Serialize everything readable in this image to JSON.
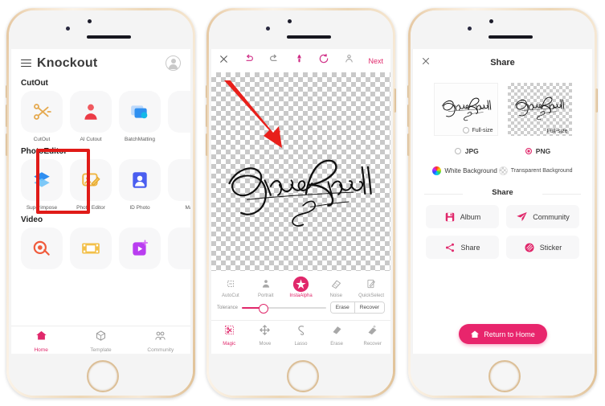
{
  "accent": "#e0286b",
  "highlight_box_color": "#e01b18",
  "arrow_color": "#e8201b",
  "phone1": {
    "app_name": "Knockout",
    "menu_icon": "hamburger-icon",
    "account_icon": "user-avatar-icon",
    "sections": [
      {
        "title": "CutOut",
        "items": [
          {
            "label": "CutOut",
            "icon": "scissors-icon",
            "highlighted": true
          },
          {
            "label": "AI Cutout",
            "icon": "person-silhouette-icon",
            "highlighted": false
          },
          {
            "label": "BatchMatting",
            "icon": "photo-stack-icon",
            "highlighted": false
          },
          {
            "label": "",
            "icon": "partial-icon",
            "highlighted": false
          }
        ]
      },
      {
        "title": "PhotoEditor",
        "items": [
          {
            "label": "Superimpose",
            "icon": "layers-icon",
            "highlighted": false
          },
          {
            "label": "Photo Editor",
            "icon": "photo-pencil-icon",
            "highlighted": false
          },
          {
            "label": "ID Photo",
            "icon": "id-card-icon",
            "highlighted": false
          },
          {
            "label": "Ma",
            "icon": "partial-icon",
            "highlighted": false
          }
        ]
      },
      {
        "title": "Video",
        "items": [
          {
            "label": "",
            "icon": "video-cutout-icon",
            "highlighted": false
          },
          {
            "label": "",
            "icon": "film-strip-icon",
            "highlighted": false
          },
          {
            "label": "",
            "icon": "video-play-icon",
            "highlighted": false
          },
          {
            "label": "",
            "icon": "partial-icon",
            "highlighted": false
          }
        ]
      }
    ],
    "tabs": [
      {
        "label": "Home",
        "icon": "home-icon",
        "active": true
      },
      {
        "label": "Template",
        "icon": "cube-icon",
        "active": false
      },
      {
        "label": "Community",
        "icon": "people-icon",
        "active": false
      }
    ]
  },
  "phone2": {
    "toolbar": {
      "close_icon": "close-x-icon",
      "undo_icon": "undo-arrow-icon",
      "redo_icon": "redo-arrow-icon",
      "brush_icon": "brush-icon",
      "reset_icon": "refresh-circle-icon",
      "compare_icon": "compare-person-icon",
      "next_label": "Next"
    },
    "canvas": {
      "signature_text": "Jane Russell",
      "background": "transparent-checkerboard",
      "pointer": "red-arrow-annotation"
    },
    "tools": [
      {
        "label": "AutoCut",
        "icon": "autocut-icon",
        "active": false
      },
      {
        "label": "Portrait",
        "icon": "portrait-icon",
        "active": false
      },
      {
        "label": "InstaAlpha",
        "icon": "instaalpha-icon",
        "active": true
      },
      {
        "label": "Noise",
        "icon": "noise-icon",
        "active": false
      },
      {
        "label": "QuickSelect",
        "icon": "quickselect-icon",
        "active": false
      }
    ],
    "tolerance": {
      "label": "Tolerance",
      "value": 25
    },
    "mode_buttons": [
      {
        "label": "Erase"
      },
      {
        "label": "Recover"
      }
    ],
    "bottom_menu": [
      {
        "label": "Magic",
        "icon": "magic-wand-icon",
        "active": true
      },
      {
        "label": "Move",
        "icon": "move-arrows-icon",
        "active": false
      },
      {
        "label": "Lasso",
        "icon": "lasso-icon",
        "active": false
      },
      {
        "label": "Erase",
        "icon": "eraser-icon",
        "active": false
      },
      {
        "label": "Recover",
        "icon": "recover-eraser-icon",
        "active": false
      }
    ]
  },
  "phone3": {
    "close_icon": "close-x-icon",
    "title": "Share",
    "previews": [
      {
        "label": "Full-size",
        "background": "white",
        "selected": false,
        "signature_text": "Jane Russell"
      },
      {
        "label": "Full-size",
        "background": "transparent",
        "selected": true,
        "signature_text": "Jane Russell"
      }
    ],
    "formats": [
      {
        "label": "JPG",
        "selected": false
      },
      {
        "label": "PNG",
        "selected": true
      }
    ],
    "backgrounds": [
      {
        "label": "White Background",
        "icon": "color-wheel-icon",
        "selected": true
      },
      {
        "label": "Transparent Background",
        "icon": "checker-circle-icon",
        "selected": false
      }
    ],
    "share_heading": "Share",
    "share_actions": [
      {
        "label": "Album",
        "icon": "album-icon"
      },
      {
        "label": "Community",
        "icon": "paper-plane-icon"
      },
      {
        "label": "Share",
        "icon": "share-nodes-icon"
      },
      {
        "label": "Sticker",
        "icon": "sticker-icon"
      }
    ],
    "return_button": {
      "label": "Return to Home",
      "icon": "home-icon"
    }
  }
}
